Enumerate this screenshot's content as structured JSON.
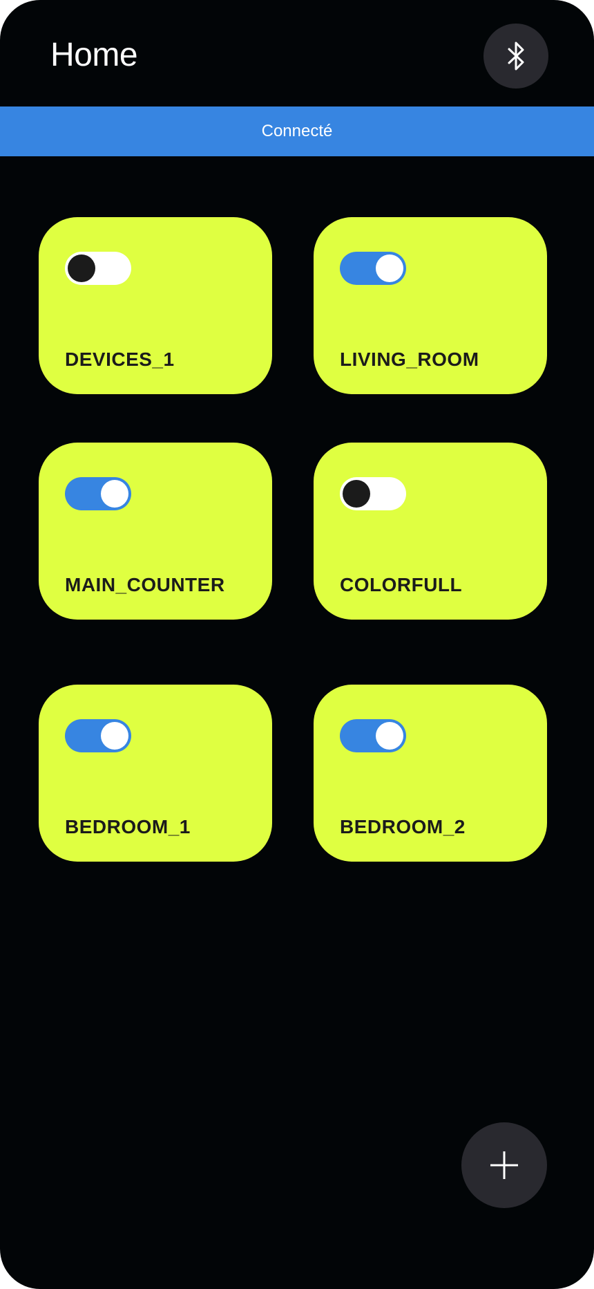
{
  "header": {
    "title": "Home",
    "bluetooth_icon": "bluetooth-icon"
  },
  "status": {
    "text": "Connecté"
  },
  "devices": [
    {
      "label": "DEVICES_1",
      "on": false
    },
    {
      "label": "LIVING_ROOM",
      "on": true
    },
    {
      "label": "MAIN_COUNTER",
      "on": true
    },
    {
      "label": "COLORFULL",
      "on": false
    },
    {
      "label": "BEDROOM_1",
      "on": true
    },
    {
      "label": "BEDROOM_2",
      "on": true
    }
  ],
  "fab": {
    "icon": "plus-icon"
  },
  "colors": {
    "background": "#020507",
    "card": "#dfff41",
    "accent": "#3785e1",
    "button": "#29292f"
  }
}
